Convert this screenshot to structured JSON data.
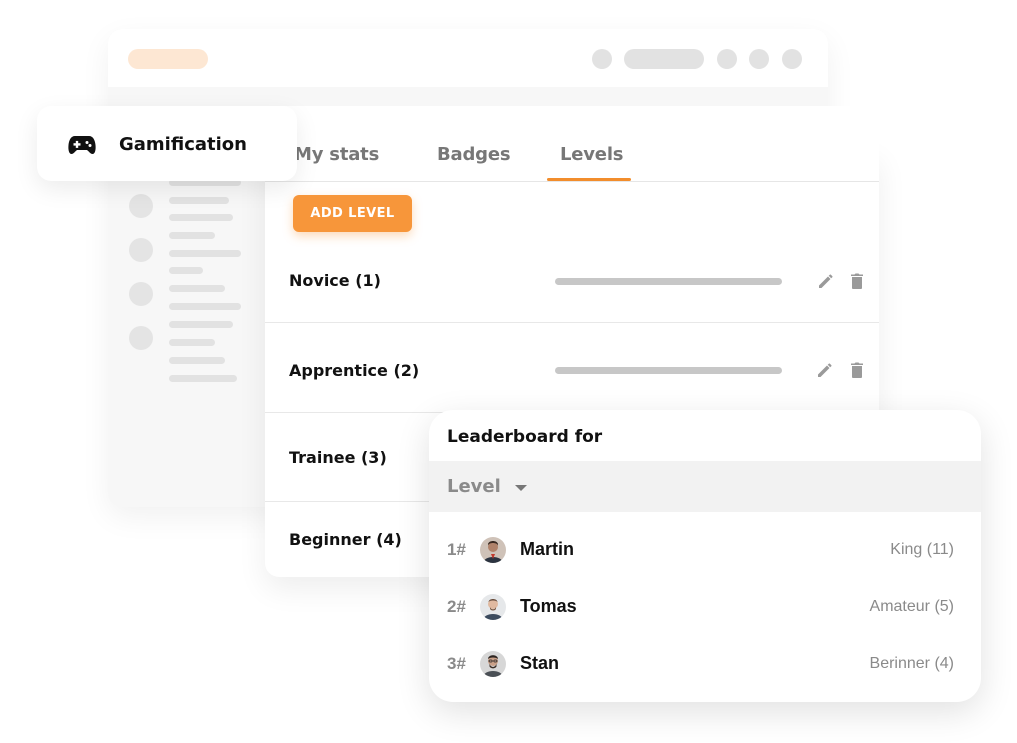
{
  "header": {
    "title": "Gamification",
    "icon": "gamepad-icon"
  },
  "tabs": [
    {
      "label": "My stats",
      "active": false
    },
    {
      "label": "Badges",
      "active": false
    },
    {
      "label": "Levels",
      "active": true
    }
  ],
  "toolbar": {
    "add_level_label": "ADD LEVEL"
  },
  "levels": [
    {
      "name": "Novice (1)",
      "edit_icon": "pencil-icon",
      "delete_icon": "trash-icon"
    },
    {
      "name": "Apprentice (2)",
      "edit_icon": "pencil-icon",
      "delete_icon": "trash-icon"
    },
    {
      "name": "Trainee (3)"
    },
    {
      "name": "Beginner (4)"
    }
  ],
  "leaderboard": {
    "title": "Leaderboard for",
    "filter": {
      "selected": "Level",
      "icon": "caret-down-icon"
    },
    "entries": [
      {
        "rank": "1#",
        "name": "Martin",
        "level": "King (11)"
      },
      {
        "rank": "2#",
        "name": "Tomas",
        "level": "Amateur (5)"
      },
      {
        "rank": "3#",
        "name": "Stan",
        "level": "Berinner (4)"
      }
    ]
  },
  "colors": {
    "accent": "#f7963a",
    "tab_underline": "#f28d2c",
    "muted_text": "#8a8a8a"
  }
}
